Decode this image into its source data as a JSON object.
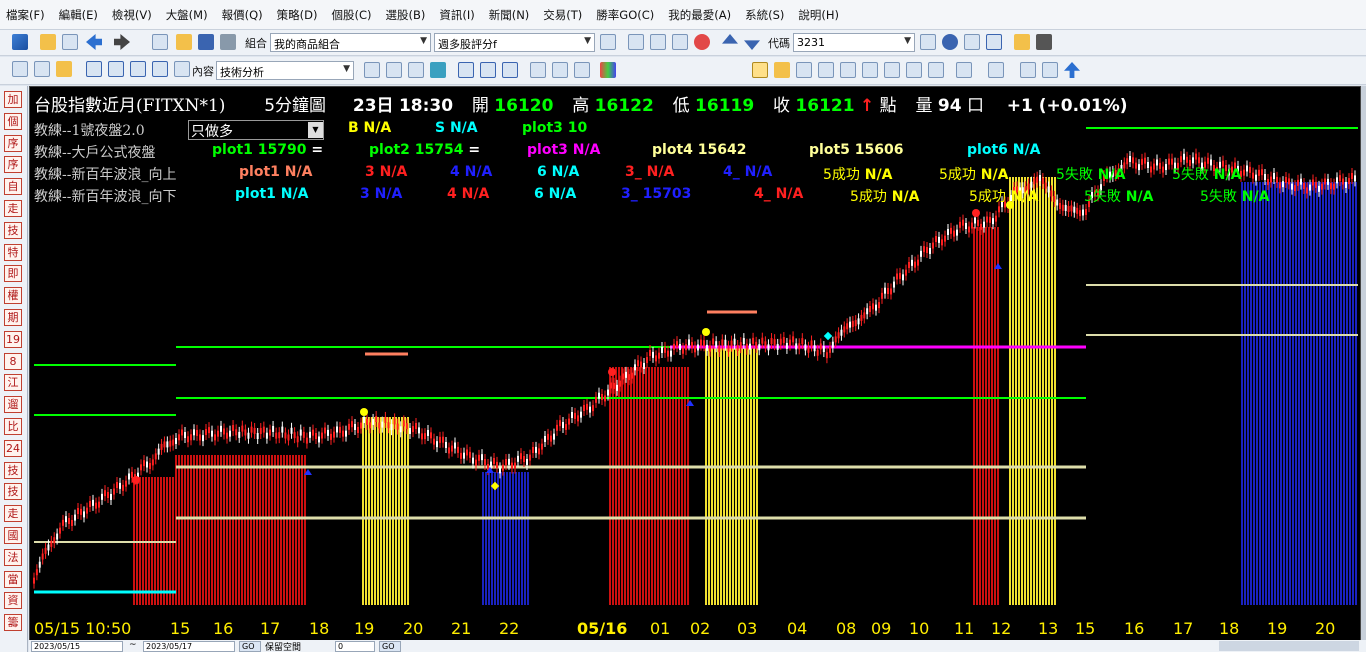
{
  "menu": [
    "檔案(F)",
    "編輯(E)",
    "檢視(V)",
    "大盤(M)",
    "報價(Q)",
    "策略(D)",
    "個股(C)",
    "選股(B)",
    "資訊(I)",
    "新聞(N)",
    "交易(T)",
    "勝率GO(C)",
    "我的最愛(A)",
    "系統(S)",
    "說明(H)"
  ],
  "toolbar1": {
    "group_label": "組合",
    "group_value": "我的商品組合",
    "scan_value": "週多股評分f",
    "code_label": "代碼",
    "code_value": "3231"
  },
  "toolbar2": {
    "content_label": "內容",
    "content_value": "技術分析"
  },
  "sidebar": [
    "加",
    "個",
    "序",
    "序",
    "自",
    "走",
    "技",
    "特",
    "即",
    "權",
    "期",
    "19",
    "8",
    "江",
    "遛",
    "比",
    "24",
    "技",
    "技",
    "走",
    "國",
    "法",
    "當",
    "資",
    "籌"
  ],
  "header": {
    "title": "台股指數近月(FITXN*1)",
    "period": "5分鐘圖",
    "day": "23日",
    "time": "18:30",
    "open_label": "開",
    "open": "16120",
    "high_label": "高",
    "high": "16122",
    "low_label": "低",
    "low": "16119",
    "close_label": "收",
    "close": "16121",
    "unit": "點",
    "vol_label": "量",
    "vol": "94",
    "vol_unit": "口",
    "change": "+1 (+0.01%)"
  },
  "mode_select": "只做多",
  "indicators": [
    {
      "name": "教練--1號夜盤2.0",
      "items": [
        {
          "text": "B",
          "val": "N/A",
          "color": "#ffff00"
        },
        {
          "text": "S",
          "val": "N/A",
          "color": "#00ffff"
        },
        {
          "text": "plot3",
          "val": "10",
          "color": "#00ff00"
        }
      ]
    },
    {
      "name": "教練--大戶公式夜盤",
      "items": [
        {
          "text": "plot1",
          "val": "15790",
          "color": "#00ff00",
          "suffix": "="
        },
        {
          "text": "plot2",
          "val": "15754",
          "color": "#00ff00",
          "suffix": "="
        },
        {
          "text": "plot3",
          "val": "N/A",
          "color": "#ff00ff"
        },
        {
          "text": "plot4",
          "val": "15642",
          "color": "#ffff99"
        },
        {
          "text": "plot5",
          "val": "15606",
          "color": "#ffff99"
        },
        {
          "text": "plot6",
          "val": "N/A",
          "color": "#00ffff"
        }
      ]
    },
    {
      "name": "教練--新百年波浪_向上",
      "items": [
        {
          "text": "plot1",
          "val": "N/A",
          "color": "#ff8060"
        },
        {
          "text": "3",
          "val": "N/A",
          "color": "#ff2020"
        },
        {
          "text": "4",
          "val": "N/A",
          "color": "#2020ff"
        },
        {
          "text": "6",
          "val": "N/A",
          "color": "#00ffff"
        },
        {
          "text": "3_",
          "val": "N/A",
          "color": "#ff2020"
        },
        {
          "text": "4_",
          "val": "N/A",
          "color": "#2020ff"
        },
        {
          "text": "5成功",
          "val": "N/A",
          "color": "#ffff00"
        },
        {
          "text": "5成功",
          "val": "N/A",
          "color": "#ffff00"
        },
        {
          "text": "5失敗",
          "val": "N/A",
          "color": "#00ff00"
        },
        {
          "text": "5失敗",
          "val": "N/A",
          "color": "#00ff00"
        }
      ]
    },
    {
      "name": "教練--新百年波浪_向下",
      "items": [
        {
          "text": "plot1",
          "val": "N/A",
          "color": "#00ffff"
        },
        {
          "text": "3",
          "val": "N/A",
          "color": "#2020ff"
        },
        {
          "text": "4",
          "val": "N/A",
          "color": "#ff2020"
        },
        {
          "text": "6",
          "val": "N/A",
          "color": "#00ffff"
        },
        {
          "text": "3_",
          "val": "15703",
          "color": "#2020ff"
        },
        {
          "text": "4_",
          "val": "N/A",
          "color": "#ff2020"
        },
        {
          "text": "5成功",
          "val": "N/A",
          "color": "#ffff00"
        },
        {
          "text": "5成功",
          "val": "N/A",
          "color": "#ffff00"
        },
        {
          "text": "5失敗",
          "val": "N/A",
          "color": "#00ff00"
        },
        {
          "text": "5失敗",
          "val": "N/A",
          "color": "#00ff00"
        }
      ]
    }
  ],
  "xaxis": [
    "05/15 10:50",
    "15",
    "16",
    "17",
    "18",
    "19",
    "20",
    "21",
    "22",
    "05/16",
    "01",
    "02",
    "03",
    "04",
    "08",
    "09",
    "10",
    "11",
    "12",
    "13",
    "15",
    "16",
    "17",
    "18",
    "19",
    "20"
  ],
  "bottom": {
    "date_from": "2023/05/15",
    "date_to": "2023/05/17",
    "tilde": "~",
    "go": "GO",
    "keep": "保留空間",
    "keep_val": "0"
  },
  "colors": {
    "up": "#ff2020",
    "down": "#ffffff",
    "bull_zone": "#cc1010",
    "gold_zone": "#f0e030",
    "bear_zone": "#1a22c0"
  }
}
